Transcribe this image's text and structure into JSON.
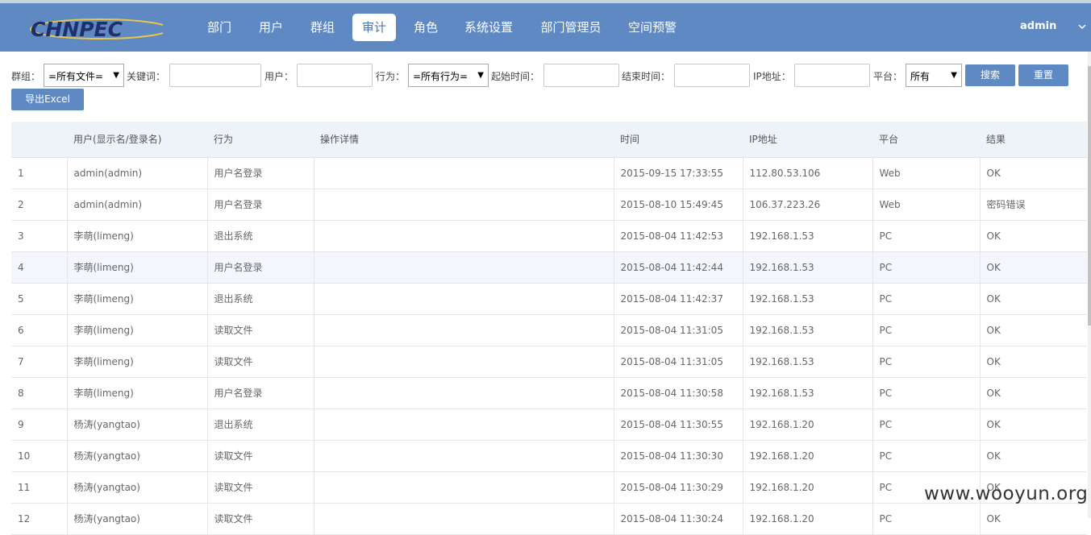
{
  "header": {
    "logo_text": "CHNPEC",
    "nav": [
      {
        "label": "部门"
      },
      {
        "label": "用户"
      },
      {
        "label": "群组"
      },
      {
        "label": "审计",
        "active": true
      },
      {
        "label": "角色"
      },
      {
        "label": "系统设置"
      },
      {
        "label": "部门管理员"
      },
      {
        "label": "空间预警"
      }
    ],
    "user": "admin"
  },
  "filters": {
    "group_label": "群组：",
    "group_value": "=所有文件=",
    "keyword_label": "关键词：",
    "keyword_value": "",
    "user_label": "用户：",
    "user_value": "",
    "action_label": "行为：",
    "action_value": "=所有行为=",
    "start_label": "起始时间：",
    "start_value": "",
    "end_label": "结束时间：",
    "end_value": "",
    "ip_label": "IP地址：",
    "ip_value": "",
    "platform_label": "平台：",
    "platform_value": "所有",
    "search_button": "搜索",
    "reset_button": "重置",
    "export_button": "导出Excel"
  },
  "table": {
    "columns": [
      "",
      "用户(显示名/登录名)",
      "行为",
      "操作详情",
      "时间",
      "IP地址",
      "平台",
      "结果"
    ],
    "rows": [
      [
        "1",
        "admin(admin)",
        "用户名登录",
        "",
        "2015-09-15 17:33:55",
        "112.80.53.106",
        "Web",
        "OK"
      ],
      [
        "2",
        "admin(admin)",
        "用户名登录",
        "",
        "2015-08-10 15:49:45",
        "106.37.223.26",
        "Web",
        "密码错误"
      ],
      [
        "3",
        "李萌(limeng)",
        "退出系统",
        "",
        "2015-08-04 11:42:53",
        "192.168.1.53",
        "PC",
        "OK"
      ],
      [
        "4",
        "李萌(limeng)",
        "用户名登录",
        "",
        "2015-08-04 11:42:44",
        "192.168.1.53",
        "PC",
        "OK"
      ],
      [
        "5",
        "李萌(limeng)",
        "退出系统",
        "",
        "2015-08-04 11:42:37",
        "192.168.1.53",
        "PC",
        "OK"
      ],
      [
        "6",
        "李萌(limeng)",
        "读取文件",
        "",
        "2015-08-04 11:31:05",
        "192.168.1.53",
        "PC",
        "OK"
      ],
      [
        "7",
        "李萌(limeng)",
        "读取文件",
        "",
        "2015-08-04 11:31:05",
        "192.168.1.53",
        "PC",
        "OK"
      ],
      [
        "8",
        "李萌(limeng)",
        "用户名登录",
        "",
        "2015-08-04 11:30:58",
        "192.168.1.53",
        "PC",
        "OK"
      ],
      [
        "9",
        "杨涛(yangtao)",
        "退出系统",
        "",
        "2015-08-04 11:30:55",
        "192.168.1.20",
        "PC",
        "OK"
      ],
      [
        "10",
        "杨涛(yangtao)",
        "读取文件",
        "",
        "2015-08-04 11:30:30",
        "192.168.1.20",
        "PC",
        "OK"
      ],
      [
        "11",
        "杨涛(yangtao)",
        "读取文件",
        "",
        "2015-08-04 11:30:29",
        "192.168.1.20",
        "PC",
        "OK"
      ],
      [
        "12",
        "杨涛(yangtao)",
        "读取文件",
        "",
        "2015-08-04 11:30:24",
        "192.168.1.20",
        "PC",
        "OK"
      ]
    ],
    "highlight_row": 3
  },
  "watermark": "www.wooyun.org",
  "colors": {
    "navbar": "#5f89c3",
    "button": "#5f89c3",
    "header_row": "#eef3fa"
  }
}
